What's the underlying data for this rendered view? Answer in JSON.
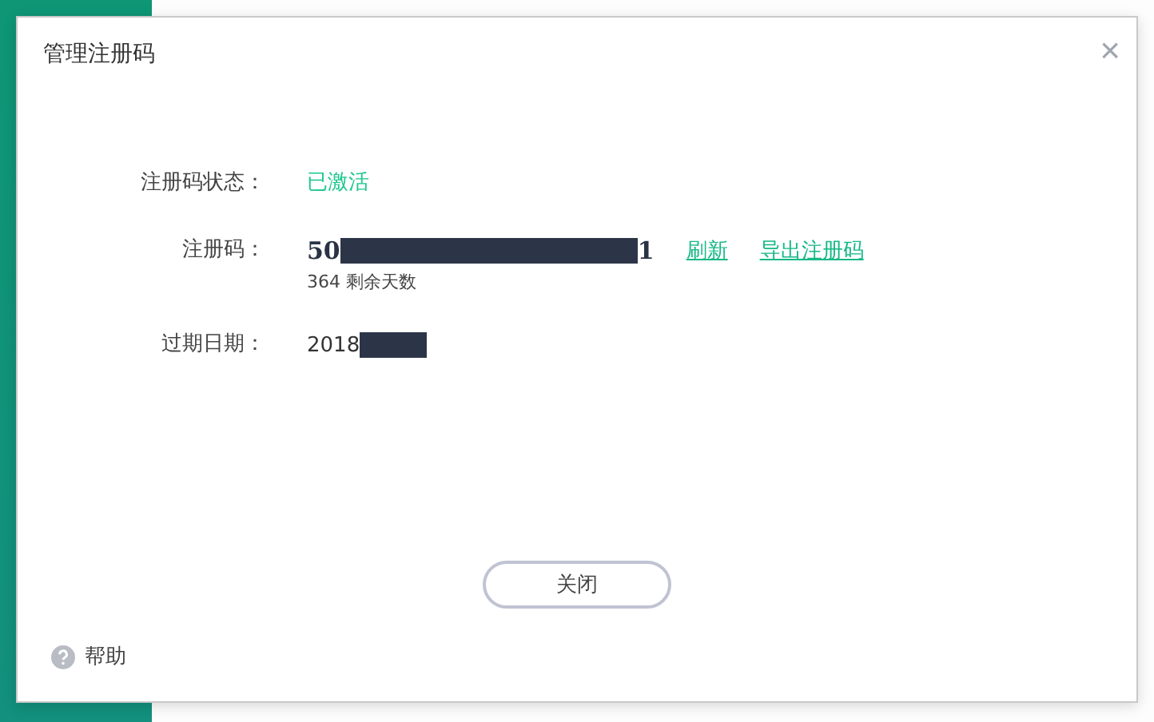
{
  "dialog": {
    "title": "管理注册码",
    "close_icon": "×"
  },
  "fields": [
    {
      "kind": "status",
      "label": "注册码状态：",
      "value": "已激活"
    },
    {
      "kind": "code",
      "label": "注册码：",
      "prefix": "50",
      "suffix": "1",
      "note": "364 剩余天数",
      "links": [
        "刷新",
        "导出注册码"
      ]
    },
    {
      "kind": "date",
      "label": "过期日期：",
      "prefix": "2018"
    }
  ],
  "buttons": [
    "关闭"
  ],
  "help": {
    "label": "帮助"
  }
}
